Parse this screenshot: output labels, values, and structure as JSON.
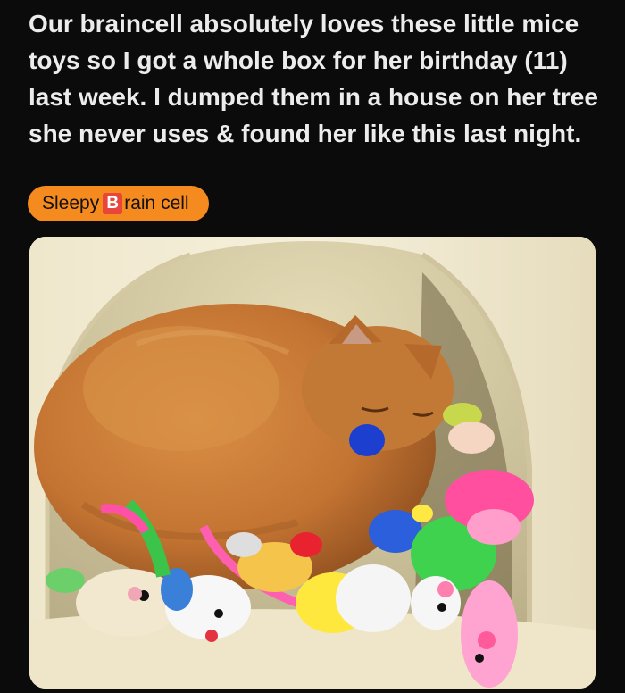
{
  "post": {
    "title": "Our braincell absolutely loves these little mice toys so I got a whole box for her birthday (11) last week. I dumped them in a house on her tree she never uses & found her like this last night.",
    "flair": {
      "text_before": "Sleepy ",
      "emoji_letter": "B",
      "text_after": "rain cell",
      "background": "#f58a1f"
    }
  },
  "colors": {
    "background": "#0b0b0c",
    "text": "#ececec",
    "cat_fur": "#c97a35"
  }
}
